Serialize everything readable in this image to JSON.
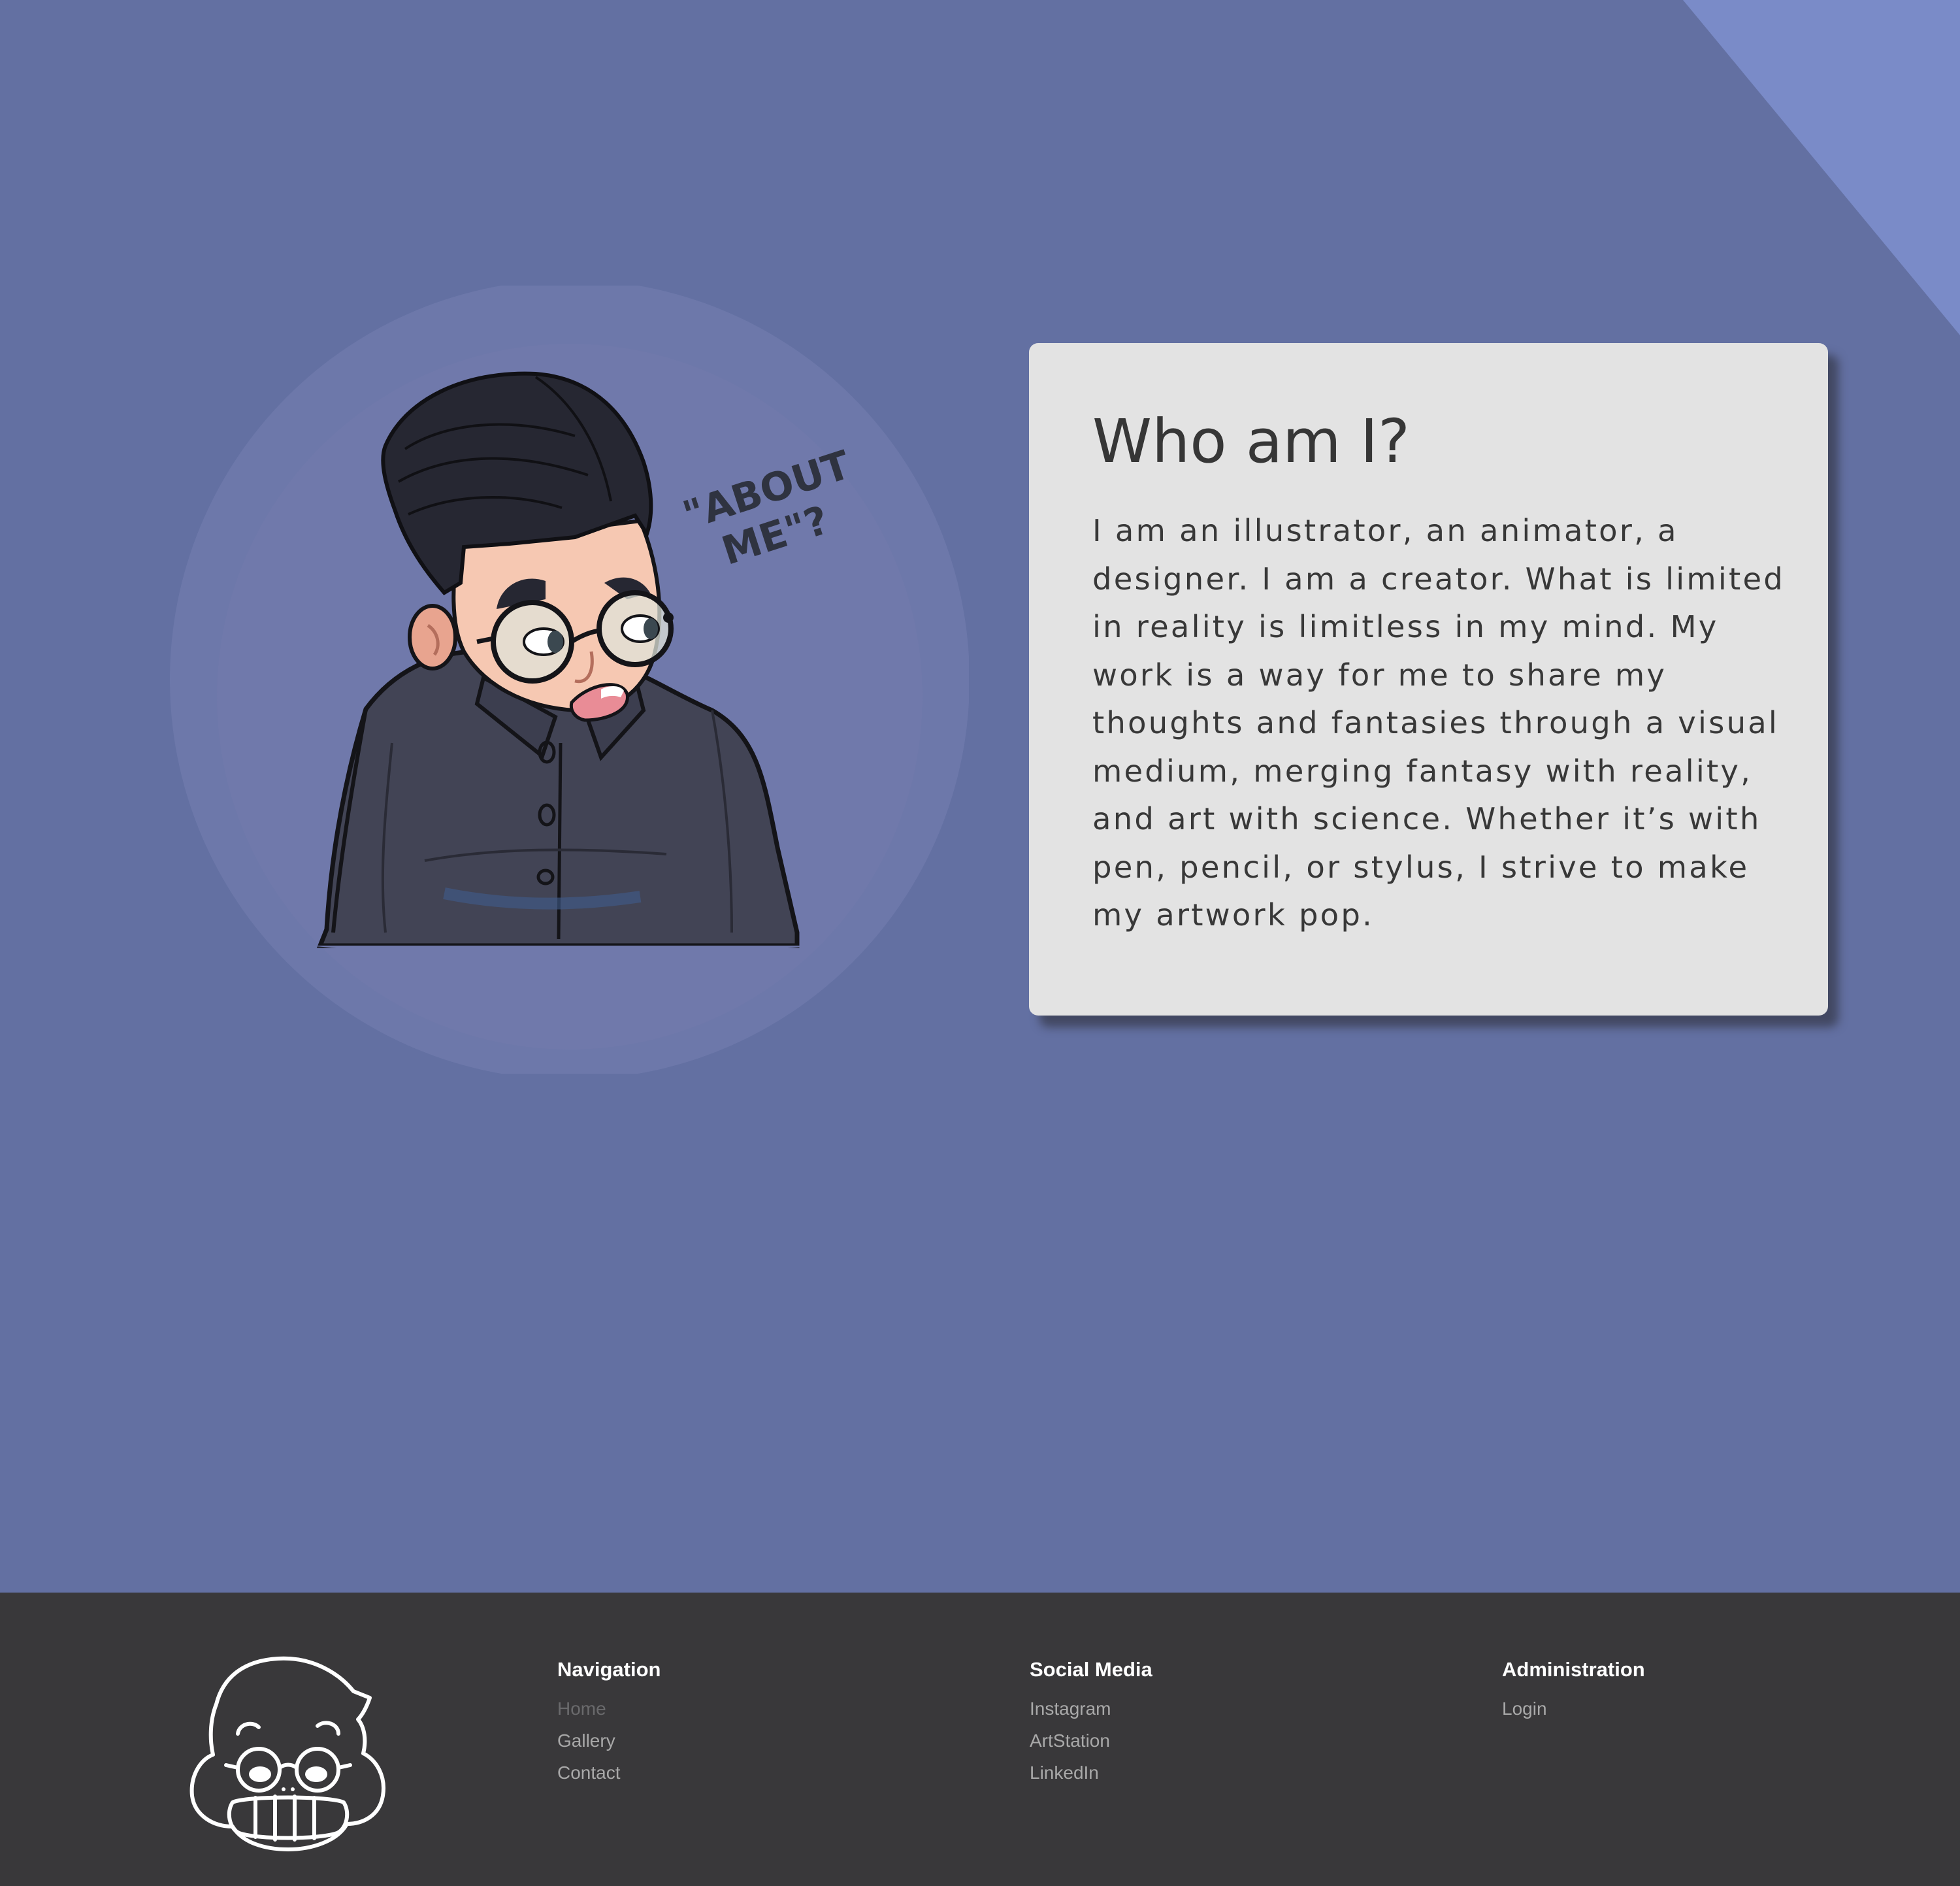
{
  "colors": {
    "page_background": "#6370a2",
    "corner_accent": "#7a8bc8",
    "card_background": "#e3e3e3",
    "footer_background": "#39383a",
    "footer_heading": "#ffffff",
    "footer_link": "#a9a9a9",
    "footer_link_active": "#6a6a6c"
  },
  "about": {
    "portrait_caption": "\"ABOUT ME\"?",
    "title": "Who am I?",
    "body": "I am an illustrator, an animator, a designer. I am a creator. What is limited in reality is limitless in my mind. My work is a way for me to share my thoughts and fantasies through a visual medium, merging fantasy with reality, and art with science. Whether it’s with pen, pencil, or stylus, I strive to make my artwork pop."
  },
  "footer": {
    "logo_icon": "cartoon-face-logo-icon",
    "navigation": {
      "heading": "Navigation",
      "links": [
        "Home",
        "Gallery",
        "Contact"
      ],
      "active": "Home"
    },
    "social": {
      "heading": "Social Media",
      "links": [
        "Instagram",
        "ArtStation",
        "LinkedIn"
      ]
    },
    "admin": {
      "heading": "Administration",
      "links": [
        "Login"
      ]
    }
  }
}
